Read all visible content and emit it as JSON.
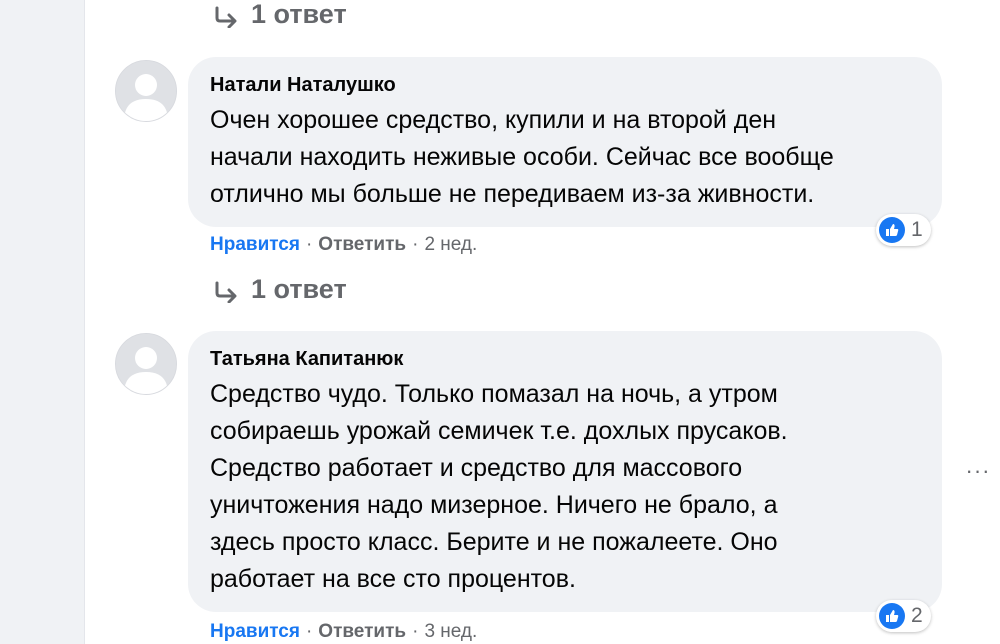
{
  "replies_link_1": {
    "label": "1 ответ"
  },
  "replies_link_2": {
    "label": "1 ответ"
  },
  "comments": [
    {
      "author": "Натали Наталушко",
      "lines": [
        "Очен хорошее средство, купили и на второй ден",
        "начали находить неживые особи. Сейчас все вообще",
        "отлично мы больше не передиваем из-за живности."
      ],
      "reaction_count": "1",
      "like_label": "Нравится",
      "reply_label": "Ответить",
      "time": "2 нед."
    },
    {
      "author": "Татьяна Капитанюк",
      "lines": [
        "Средство чудо. Только помазал на ночь, а утром",
        "собираешь урожай семичек т.е. дохлых прусаков.",
        "Средство работает и средство для массового",
        "уничтожения надо мизерное. Ничего не брало, а",
        "здесь просто класс. Берите и не пожалеете. Оно",
        "работает на все сто процентов."
      ],
      "reaction_count": "2",
      "like_label": "Нравится",
      "reply_label": "Ответить",
      "time": "3 нед."
    }
  ],
  "separator": "·",
  "more_options_label": "···",
  "icons": {
    "reply_arrow": "reply-arrow-icon",
    "like": "thumbs-up-icon",
    "avatar": "default-avatar-icon",
    "more": "more-options-icon"
  },
  "colors": {
    "accent": "#1877f2",
    "bubble": "#f0f2f5",
    "secondary_text": "#65676b"
  }
}
